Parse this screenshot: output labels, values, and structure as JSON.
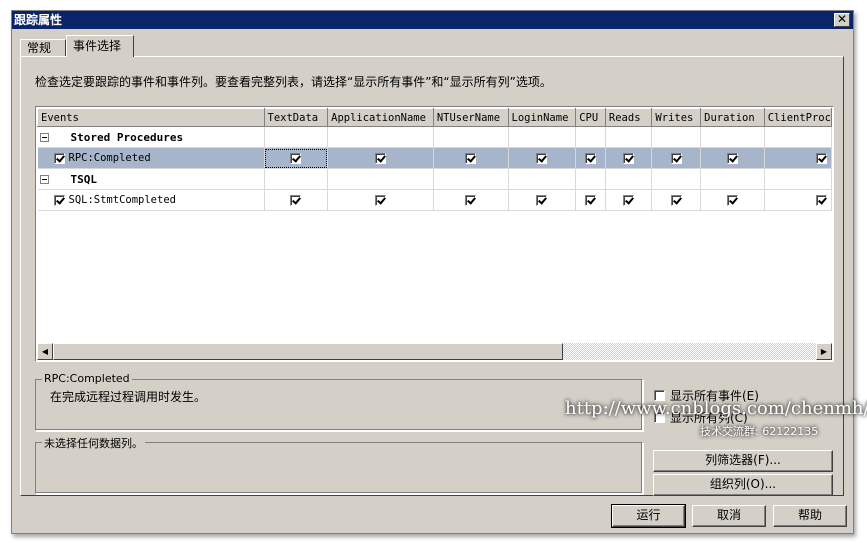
{
  "window": {
    "title": "跟踪属性",
    "close_label": "✕"
  },
  "tabs": [
    {
      "label": "常规",
      "active": false
    },
    {
      "label": "事件选择",
      "active": true
    }
  ],
  "instruction": "检查选定要跟踪的事件和事件列。要查看完整列表，请选择“显示所有事件”和“显示所有列”选项。",
  "grid": {
    "columns": [
      "Events",
      "TextData",
      "ApplicationName",
      "NTUserName",
      "LoginName",
      "CPU",
      "Reads",
      "Writes",
      "Duration",
      "ClientProc"
    ],
    "categories": [
      {
        "name": "Stored Procedures",
        "expanded": true,
        "events": [
          {
            "name": "RPC:Completed",
            "checked": true,
            "selected": true,
            "columns": [
              true,
              true,
              true,
              true,
              true,
              true,
              true,
              true,
              true
            ]
          }
        ]
      },
      {
        "name": "TSQL",
        "expanded": true,
        "events": [
          {
            "name": "SQL:StmtCompleted",
            "checked": true,
            "selected": false,
            "columns": [
              true,
              true,
              true,
              true,
              true,
              true,
              true,
              true,
              true
            ]
          }
        ]
      }
    ],
    "scroll_left_label": "◀",
    "scroll_right_label": "▶"
  },
  "event_description": {
    "title": "RPC:Completed",
    "text": "在完成远程过程调用时发生。"
  },
  "column_description": {
    "title": "未选择任何数据列。"
  },
  "options": {
    "show_all_events": {
      "label": "显示所有事件(E)",
      "checked": false
    },
    "show_all_columns": {
      "label": "显示所有列(C)",
      "checked": false
    }
  },
  "buttons": {
    "column_filters": "列筛选器(F)...",
    "organize_columns": "组织列(O)...",
    "run": "运行",
    "cancel": "取消",
    "help": "帮助"
  },
  "watermark": {
    "url": "http://www.cnblogs.com/chenmh/",
    "group": "技术交流群: 62122135"
  }
}
